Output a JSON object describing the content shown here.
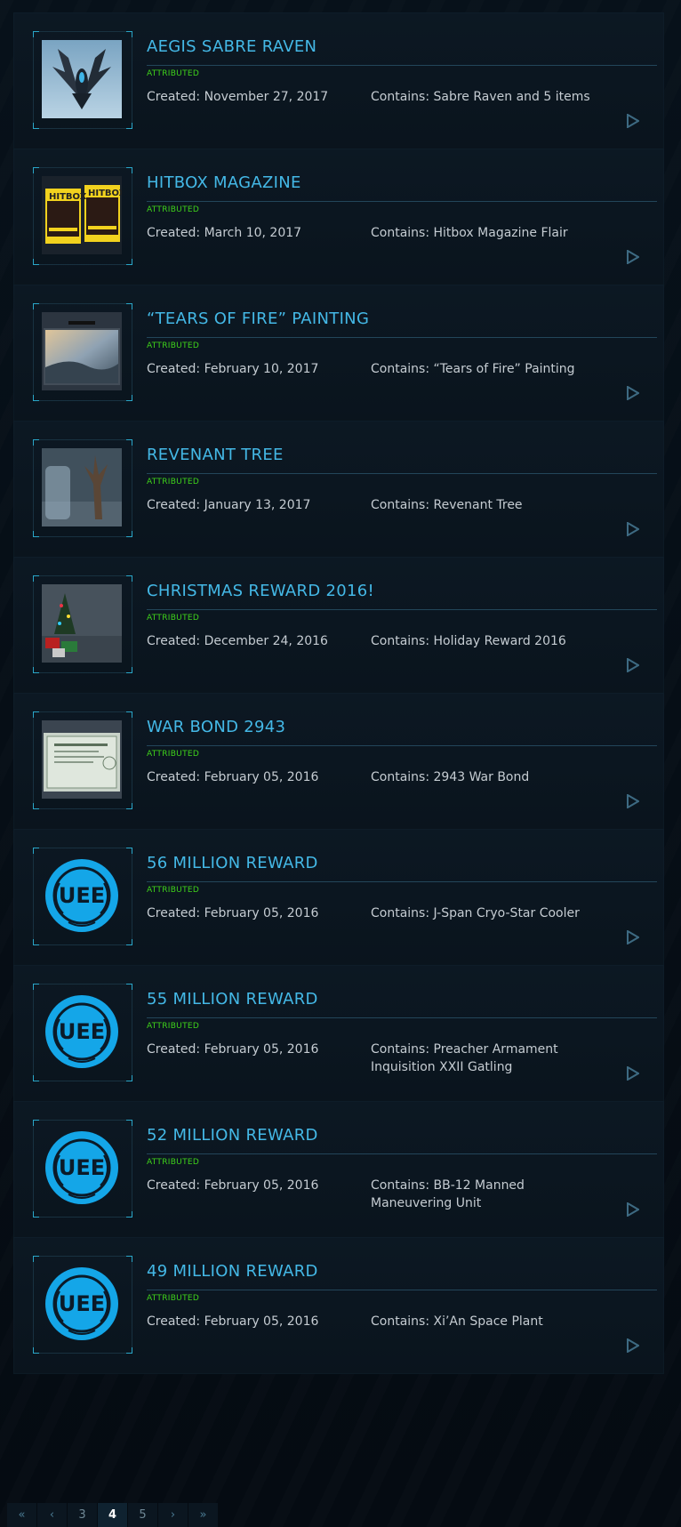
{
  "status_label": "ATTRIBUTED",
  "pledges": [
    {
      "title": "AEGIS SABRE RAVEN",
      "created": "Created: November 27, 2017",
      "contains": "Contains: Sabre Raven and 5 items",
      "thumb": "ship"
    },
    {
      "title": "HITBOX MAGAZINE",
      "created": "Created: March 10, 2017",
      "contains": "Contains: Hitbox Magazine Flair",
      "thumb": "magazine"
    },
    {
      "title": "“TEARS OF FIRE” PAINTING",
      "created": "Created: February 10, 2017",
      "contains": "Contains: “Tears of Fire” Painting",
      "thumb": "painting"
    },
    {
      "title": "REVENANT TREE",
      "created": "Created: January 13, 2017",
      "contains": "Contains: Revenant Tree",
      "thumb": "tree"
    },
    {
      "title": "CHRISTMAS REWARD 2016!",
      "created": "Created: December 24, 2016",
      "contains": "Contains: Holiday Reward 2016",
      "thumb": "christmas"
    },
    {
      "title": "WAR BOND 2943",
      "created": "Created: February 05, 2016",
      "contains": "Contains: 2943 War Bond",
      "thumb": "bond"
    },
    {
      "title": "56 MILLION REWARD",
      "created": "Created: February 05, 2016",
      "contains": "Contains: J-Span Cryo-Star Cooler",
      "thumb": "uee"
    },
    {
      "title": "55 MILLION REWARD",
      "created": "Created: February 05, 2016",
      "contains": "Contains: Preacher Armament Inquisition XXII Gatling",
      "thumb": "uee"
    },
    {
      "title": "52 MILLION REWARD",
      "created": "Created: February 05, 2016",
      "contains": "Contains: BB-12 Manned Maneuvering Unit",
      "thumb": "uee"
    },
    {
      "title": "49 MILLION REWARD",
      "created": "Created: February 05, 2016",
      "contains": "Contains: Xi’An Space Plant",
      "thumb": "uee"
    }
  ],
  "pagination": {
    "first": "«",
    "prev": "‹",
    "pages": [
      "3",
      "4",
      "5"
    ],
    "current": "4",
    "next": "›",
    "last": "»"
  },
  "colors": {
    "accent": "#44b8e6",
    "status": "#3fd21a",
    "uee_logo": "#14a6e8"
  }
}
